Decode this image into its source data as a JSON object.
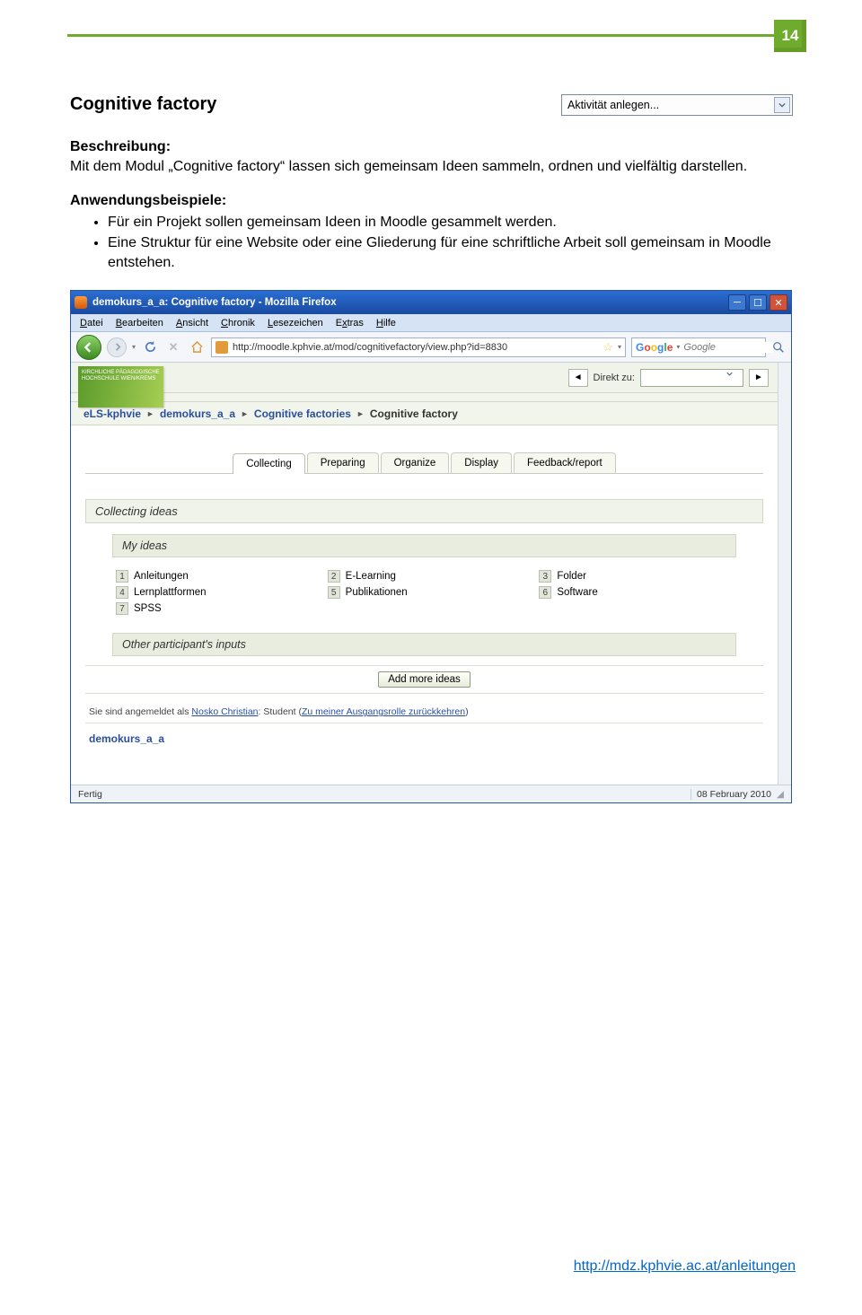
{
  "page_number": "14",
  "doc_title": "Cognitive factory",
  "activity_select_value": "Aktivität anlegen...",
  "description_label": "Beschreibung:",
  "description_text": "Mit dem Modul „Cognitive factory“ lassen sich gemeinsam Ideen sammeln, ordnen und vielfältig darstellen.",
  "examples_label": "Anwendungsbeispiele:",
  "bullets": [
    "Für ein Projekt sollen gemeinsam Ideen in Moodle gesammelt werden.",
    "Eine Struktur für eine Website oder eine Gliederung für eine schriftliche Arbeit soll gemeinsam in Moodle entstehen."
  ],
  "firefox": {
    "title": "demokurs_a_a: Cognitive factory - Mozilla Firefox",
    "menu": [
      "Datei",
      "Bearbeiten",
      "Ansicht",
      "Chronik",
      "Lesezeichen",
      "Extras",
      "Hilfe"
    ],
    "url": "http://moodle.kphvie.at/mod/cognitivefactory/view.php?id=8830",
    "search_placeholder": "Google",
    "status_left": "Fertig",
    "status_right": "08 February 2010"
  },
  "moodle": {
    "banner_text": "KIRCHLICHE PÄDAGOGISCHE HOCHSCHULE WIEN/KREMS",
    "direkt_label": "Direkt zu:",
    "breadcrumb": {
      "items": [
        "eLS-kphvie",
        "demokurs_a_a",
        "Cognitive factories"
      ],
      "current": "Cognitive factory"
    },
    "tabs": [
      "Collecting",
      "Preparing",
      "Organize",
      "Display",
      "Feedback/report"
    ],
    "active_tab": 0,
    "section_title": "Collecting ideas",
    "my_ideas_label": "My ideas",
    "ideas": [
      {
        "n": "1",
        "t": "Anleitungen"
      },
      {
        "n": "2",
        "t": "E-Learning"
      },
      {
        "n": "3",
        "t": "Folder"
      },
      {
        "n": "4",
        "t": "Lernplattformen"
      },
      {
        "n": "5",
        "t": "Publikationen"
      },
      {
        "n": "6",
        "t": "Software"
      },
      {
        "n": "7",
        "t": "SPSS"
      }
    ],
    "other_inputs_label": "Other participant's inputs",
    "add_more_label": "Add more ideas",
    "login_line_prefix": "Sie sind angemeldet als ",
    "login_user": "Nosko Christian",
    "login_role": ": Student (",
    "login_link": "Zu meiner Ausgangsrolle zurückkehren",
    "login_suffix": ")",
    "course_link": "demokurs_a_a"
  },
  "footer_link_text": "http://mdz.kphvie.ac.at/anleitungen"
}
